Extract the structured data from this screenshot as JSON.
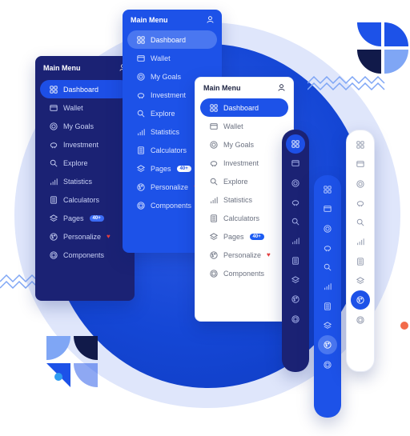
{
  "menu_title": "Main Menu",
  "items": [
    {
      "key": "dashboard",
      "label": "Dashboard",
      "icon": "dashboard-icon"
    },
    {
      "key": "wallet",
      "label": "Wallet",
      "icon": "wallet-icon"
    },
    {
      "key": "goals",
      "label": "My Goals",
      "icon": "target-icon"
    },
    {
      "key": "investment",
      "label": "Investment",
      "icon": "piggy-bank-icon"
    },
    {
      "key": "explore",
      "label": "Explore",
      "icon": "search-icon"
    },
    {
      "key": "statistics",
      "label": "Statistics",
      "icon": "bar-chart-icon"
    },
    {
      "key": "calculators",
      "label": "Calculators",
      "icon": "calculator-icon"
    },
    {
      "key": "pages",
      "label": "Pages",
      "icon": "layers-icon",
      "badge": "40+"
    },
    {
      "key": "personalize",
      "label": "Personalize",
      "icon": "palette-icon",
      "heart": true
    },
    {
      "key": "components",
      "label": "Components",
      "icon": "components-icon"
    }
  ],
  "colors": {
    "navy": "#1b2274",
    "blue": "#1d52e8",
    "accent": "#1d4fe6",
    "heart": "#e53e3e",
    "orange": "#f26b4a",
    "cyan": "#2f9cf0"
  },
  "panels": [
    {
      "name": "navy-panel",
      "active": "dashboard"
    },
    {
      "name": "blue-panel",
      "active": "dashboard"
    },
    {
      "name": "white-panel",
      "active": "dashboard"
    }
  ],
  "rails": [
    {
      "name": "navy-rail",
      "active": "dashboard"
    },
    {
      "name": "blue-rail",
      "active": "personalize"
    },
    {
      "name": "white-rail",
      "active": "personalize"
    }
  ]
}
